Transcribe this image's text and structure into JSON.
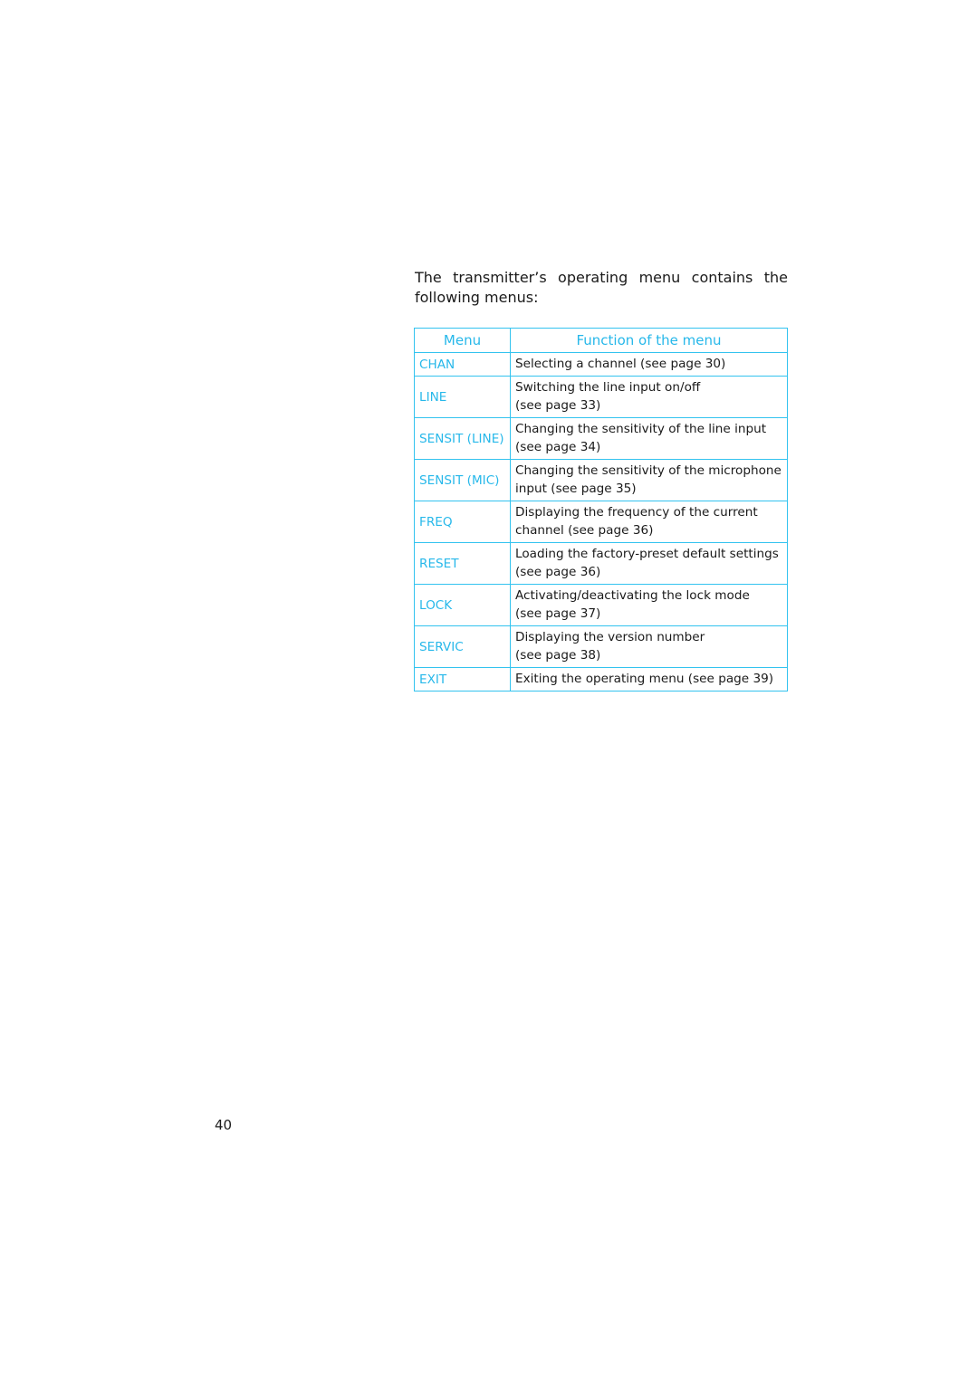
{
  "intro": {
    "line1": "The transmitter’s operating menu contains the",
    "line2": "following menus:"
  },
  "table": {
    "headers": {
      "menu": "Menu",
      "function": "Function of the menu"
    },
    "rows": [
      {
        "menu": "CHAN",
        "function_lines": [
          "Selecting a channel (see page 30)"
        ]
      },
      {
        "menu": "LINE",
        "function_lines": [
          "Switching the line input on/off",
          "(see page 33)"
        ]
      },
      {
        "menu": "SENSIT (LINE)",
        "function_lines": [
          "Changing the sensitivity of the line input",
          "(see page 34)"
        ]
      },
      {
        "menu": "SENSIT (MIC)",
        "function_lines": [
          "Changing the sensitivity of the microphone",
          "input (see page 35)"
        ]
      },
      {
        "menu": "FREQ",
        "function_lines": [
          "Displaying the frequency of the current",
          "channel (see page 36)"
        ]
      },
      {
        "menu": "RESET",
        "function_lines": [
          "Loading the factory-preset default settings",
          "(see page 36)"
        ]
      },
      {
        "menu": "LOCK",
        "function_lines": [
          "Activating/deactivating the lock mode",
          "(see page 37)"
        ]
      },
      {
        "menu": "SERVIC",
        "function_lines": [
          "Displaying the version number",
          "(see page 38)"
        ]
      },
      {
        "menu": "EXIT",
        "function_lines": [
          "Exiting the operating menu (see page 39)"
        ]
      }
    ]
  },
  "page_number": "40",
  "colors": {
    "accent": "#27b8ea",
    "border": "#33c3ef",
    "text": "#1a1a1a"
  }
}
